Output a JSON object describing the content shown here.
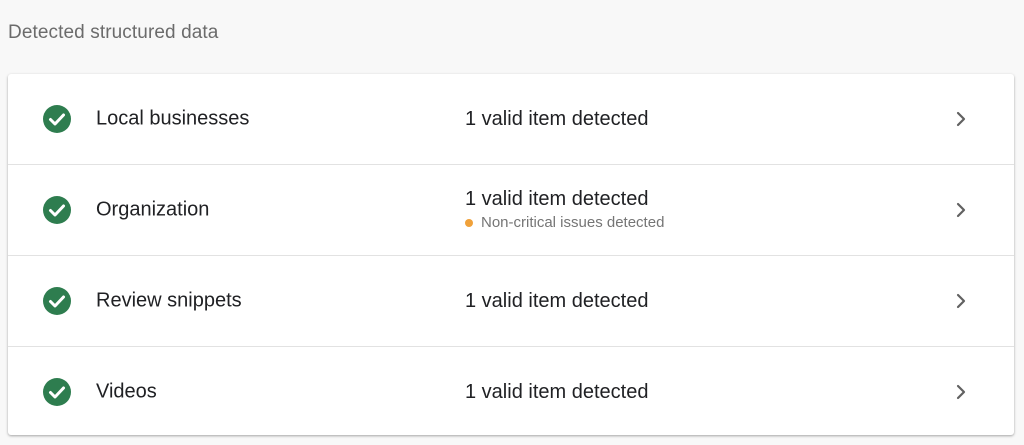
{
  "section": {
    "title": "Detected structured data"
  },
  "colors": {
    "valid_green": "#2e7d4f",
    "warning_orange": "#f0a13a",
    "chevron_gray": "#616161"
  },
  "rows": [
    {
      "label": "Local businesses",
      "summary": "1 valid item detected",
      "status_icon": "check-circle-icon",
      "nav_icon": "chevron-right-icon"
    },
    {
      "label": "Organization",
      "summary": "1 valid item detected",
      "warning": "Non-critical issues detected",
      "status_icon": "check-circle-icon",
      "nav_icon": "chevron-right-icon"
    },
    {
      "label": "Review snippets",
      "summary": "1 valid item detected",
      "status_icon": "check-circle-icon",
      "nav_icon": "chevron-right-icon"
    },
    {
      "label": "Videos",
      "summary": "1 valid item detected",
      "status_icon": "check-circle-icon",
      "nav_icon": "chevron-right-icon"
    }
  ]
}
